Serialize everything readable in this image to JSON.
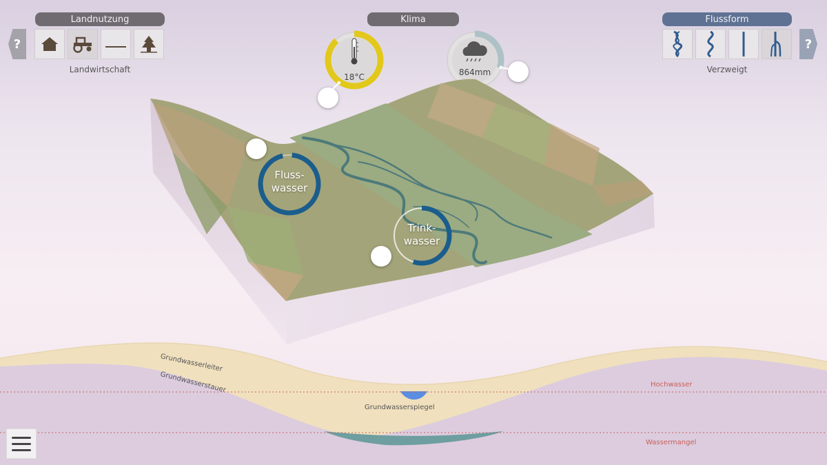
{
  "landuse": {
    "title": "Landnutzung",
    "caption": "Landwirtschaft",
    "help": "?",
    "options": [
      {
        "icon": "house-icon"
      },
      {
        "icon": "tractor-icon",
        "selected": true
      },
      {
        "icon": "flat-land-icon"
      },
      {
        "icon": "tree-icon"
      }
    ]
  },
  "climate": {
    "title": "Klima",
    "temperature": "18°C",
    "precipitation": "864mm",
    "temperature_color": "#e2c81a",
    "temperature_level": 0.88,
    "precipitation_level": 0.3
  },
  "riverform": {
    "title": "Flussform",
    "caption": "Verzweigt",
    "help": "?",
    "options": [
      {
        "icon": "braided-river-icon"
      },
      {
        "icon": "meandering-river-icon"
      },
      {
        "icon": "straight-river-icon"
      },
      {
        "icon": "branched-river-icon",
        "selected": true
      }
    ]
  },
  "indicators": {
    "river_water": {
      "line1": "Fluss-",
      "line2": "wasser",
      "color": "#1b5d8c",
      "level": 0.95
    },
    "drinking_water": {
      "line1": "Trink-",
      "line2": "wasser",
      "color": "#1b5d8c",
      "level": 0.55
    }
  },
  "cross_section": {
    "aquifer": "Grundwasserleiter",
    "aquitard": "Grundwasserstauer",
    "water_table": "Grundwasserspiegel",
    "flood": "Hochwasser",
    "shortage": "Wassermangel"
  }
}
